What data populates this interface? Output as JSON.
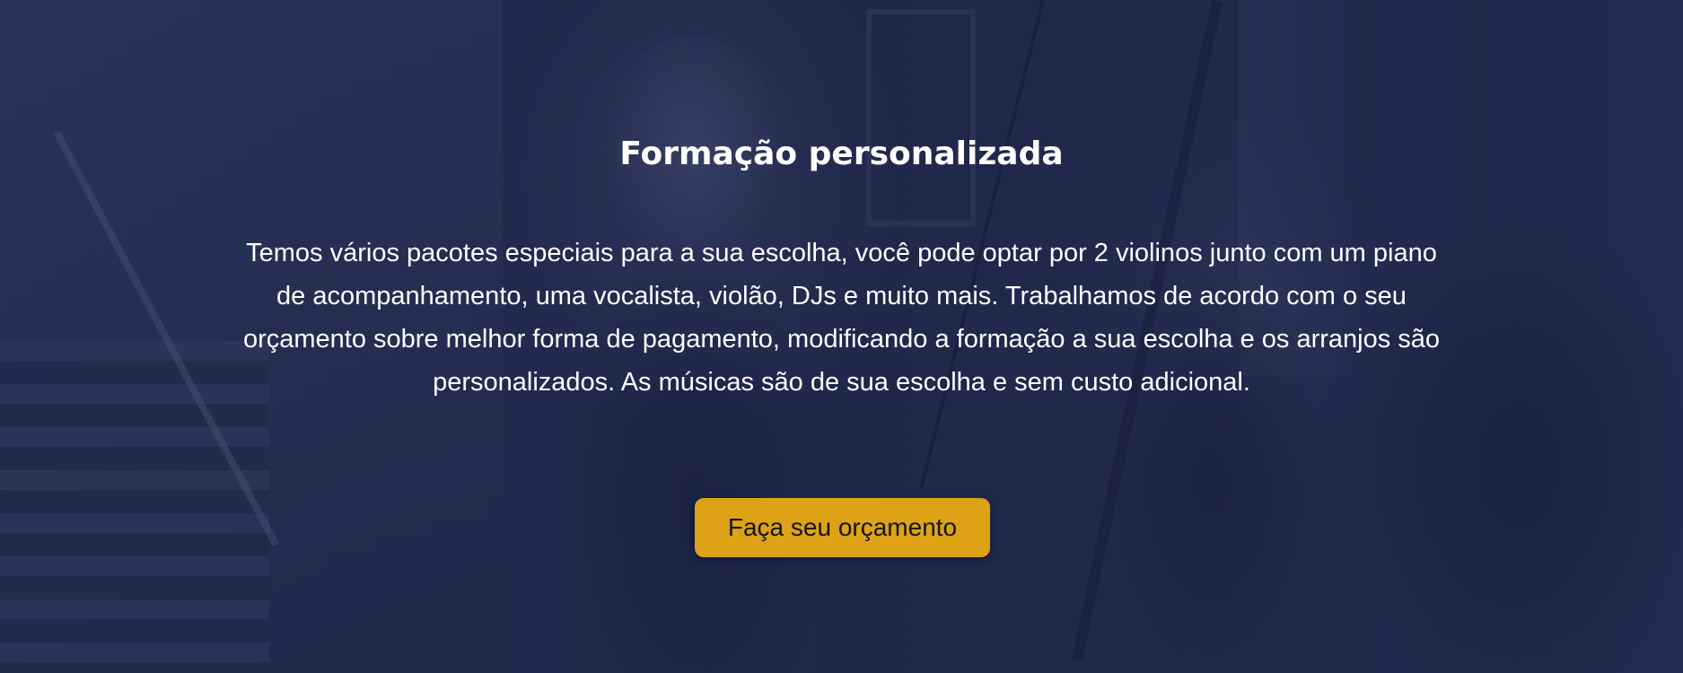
{
  "hero": {
    "title": "Formação personalizada",
    "description": "Temos vários pacotes especiais para a sua escolha, você pode optar por 2 violinos junto com um piano de acompanhamento, uma vocalista, violão, DJs e muito mais. Trabalhamos de acordo com o seu orçamento sobre  melhor forma de pagamento, modificando a formação a sua escolha e os arranjos são personalizados. As músicas são de sua escolha e sem custo adicional.",
    "cta_label": "Faça seu orçamento"
  },
  "colors": {
    "overlay": "#1c2448",
    "cta_background": "#dea216",
    "title_text": "#ffffff",
    "cta_text": "#141414"
  }
}
